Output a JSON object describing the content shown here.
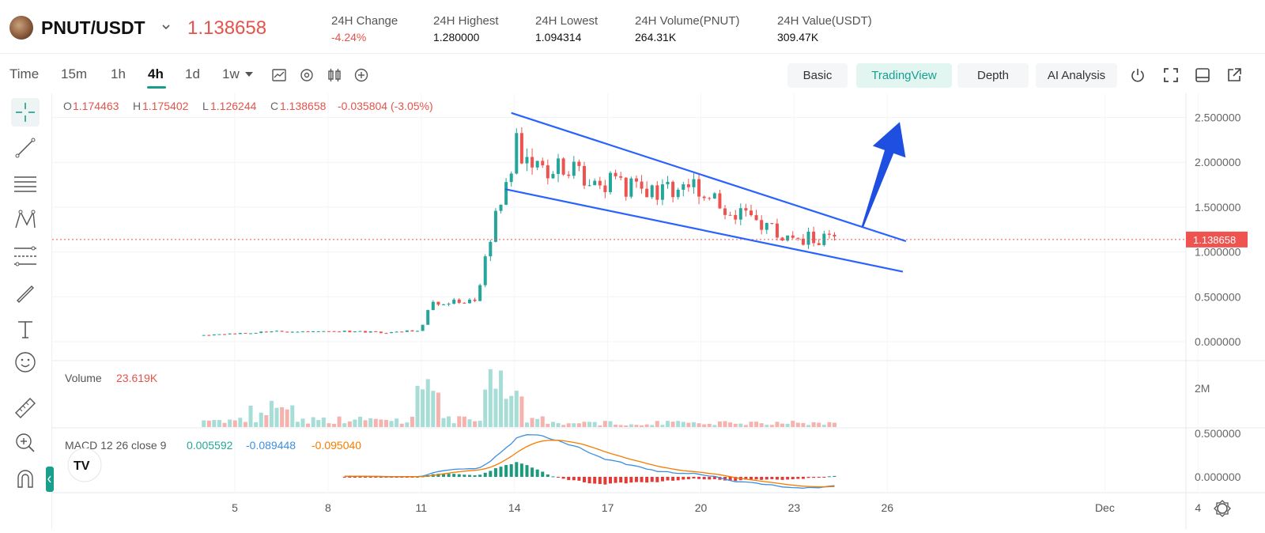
{
  "header": {
    "pair": "PNUT/USDT",
    "last_price": "1.138658",
    "stats": [
      {
        "label": "24H Change",
        "value": "-4.24%",
        "negative": true
      },
      {
        "label": "24H Highest",
        "value": "1.280000",
        "negative": false
      },
      {
        "label": "24H Lowest",
        "value": "1.094314",
        "negative": false
      },
      {
        "label": "24H Volume(PNUT)",
        "value": "264.31K",
        "negative": false
      },
      {
        "label": "24H Value(USDT)",
        "value": "309.47K",
        "negative": false
      }
    ]
  },
  "toolbar": {
    "time_label": "Time",
    "timeframes": [
      "15m",
      "1h",
      "4h",
      "1d",
      "1w"
    ],
    "active_timeframe": "4h",
    "tabs": [
      "Basic",
      "TradingView",
      "Depth",
      "AI Analysis"
    ],
    "active_tab": "TradingView"
  },
  "ohlc": {
    "o_label": "O",
    "o": "1.174463",
    "h_label": "H",
    "h": "1.175402",
    "l_label": "L",
    "l": "1.126244",
    "c_label": "C",
    "c": "1.138658",
    "change": "-0.035804 (-3.05%)"
  },
  "volume": {
    "label": "Volume",
    "value": "23.619K"
  },
  "macd": {
    "label": "MACD 12 26 close 9",
    "hist": "0.005592",
    "macd": "-0.089448",
    "signal": "-0.095040"
  },
  "colors": {
    "up": "#26a69a",
    "down": "#ef5350",
    "trendline": "#2962ff",
    "arrow": "#1f4fe0",
    "accent": "#18a08d"
  },
  "chart_data": {
    "type": "candlestick",
    "price_axis_ticks": [
      "2.500000",
      "2.000000",
      "1.500000",
      "1.000000",
      "0.500000",
      "0.000000"
    ],
    "price_ylim": [
      0,
      2.5
    ],
    "current_price_label": "1.138658",
    "volume_axis_ticks": [
      "2M"
    ],
    "macd_axis_ticks": [
      "0.500000",
      "0.000000"
    ],
    "x_ticks": [
      "5",
      "8",
      "11",
      "14",
      "17",
      "20",
      "23",
      "26",
      "Dec",
      "4"
    ],
    "anchors": [
      {
        "day": 4.0,
        "price": 0.07
      },
      {
        "day": 6.0,
        "price": 0.11
      },
      {
        "day": 8.0,
        "price": 0.12
      },
      {
        "day": 10.0,
        "price": 0.1
      },
      {
        "day": 11.0,
        "price": 0.13
      },
      {
        "day": 11.3,
        "price": 0.42
      },
      {
        "day": 12.0,
        "price": 0.45
      },
      {
        "day": 12.8,
        "price": 0.44
      },
      {
        "day": 13.0,
        "price": 0.8
      },
      {
        "day": 13.5,
        "price": 1.55
      },
      {
        "day": 13.8,
        "price": 1.7
      },
      {
        "day": 14.0,
        "price": 2.25
      },
      {
        "day": 14.5,
        "price": 1.9
      },
      {
        "day": 15.5,
        "price": 1.95
      },
      {
        "day": 16.5,
        "price": 1.85
      },
      {
        "day": 17.5,
        "price": 1.7
      },
      {
        "day": 18.5,
        "price": 1.65
      },
      {
        "day": 19.5,
        "price": 1.8
      },
      {
        "day": 20.5,
        "price": 1.6
      },
      {
        "day": 21.5,
        "price": 1.35
      },
      {
        "day": 22.5,
        "price": 1.2
      },
      {
        "day": 23.0,
        "price": 1.1
      },
      {
        "day": 23.5,
        "price": 1.18
      },
      {
        "day": 24.3,
        "price": 1.14
      }
    ],
    "candle_start_day": 4.0,
    "candle_end_day": 24.3,
    "candle_count": 122,
    "trendlines": [
      {
        "x1": 13.9,
        "y1": 2.55,
        "x2": 26.6,
        "y2": 1.12
      },
      {
        "x1": 13.7,
        "y1": 1.7,
        "x2": 26.5,
        "y2": 0.78
      }
    ],
    "arrow": {
      "from_day": 25.2,
      "from_price": 1.28,
      "to_day": 26.4,
      "to_price": 2.45
    }
  }
}
